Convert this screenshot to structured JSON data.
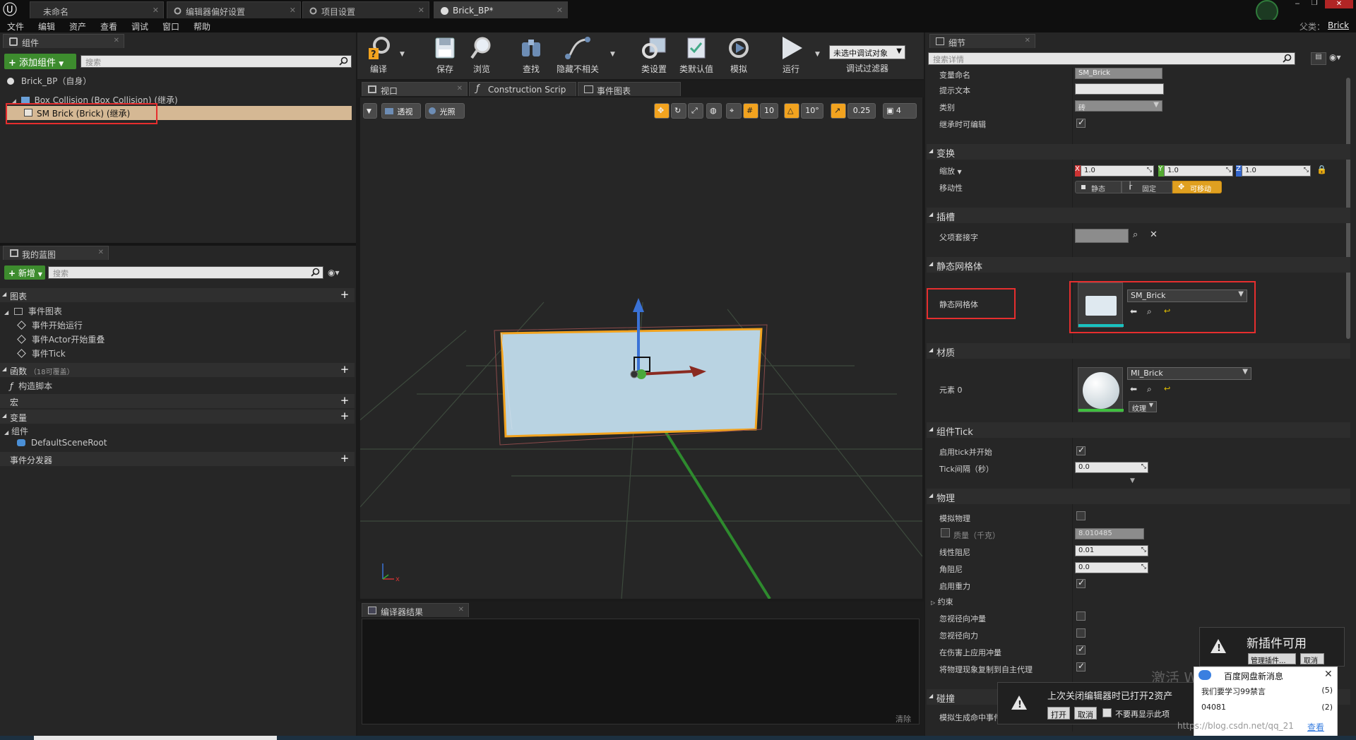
{
  "titlebar": {
    "tabs": [
      {
        "label": "未命名"
      },
      {
        "label": "编辑器偏好设置"
      },
      {
        "label": "项目设置"
      },
      {
        "label": "Brick_BP*"
      }
    ],
    "parent_label": "父类：",
    "parent_value": "Brick"
  },
  "menu": [
    "文件",
    "编辑",
    "资产",
    "查看",
    "调试",
    "窗口",
    "帮助"
  ],
  "components": {
    "tab": "组件",
    "add_button": "添加组件",
    "search_placeholder": "搜索",
    "root": "Brick_BP（自身）",
    "items": [
      "Box Collision (Box Collision) (继承)",
      "SM Brick (Brick) (继承)"
    ]
  },
  "my_blueprint": {
    "tab": "我的蓝图",
    "new_button": "新增",
    "search_placeholder": "搜索",
    "sections": {
      "graphs": "图表",
      "event_graph": "事件图表",
      "events": [
        "事件开始运行",
        "事件Actor开始重叠",
        "事件Tick"
      ],
      "functions": "函数",
      "functions_count": "（18可覆盖）",
      "construction": "构造脚本",
      "macros": "宏",
      "variables": "变量",
      "components_group": "组件",
      "default_root": "DefaultSceneRoot",
      "dispatchers": "事件分发器"
    }
  },
  "toolbar": {
    "buttons": [
      "编译",
      "保存",
      "浏览",
      "查找",
      "隐藏不相关",
      "类设置",
      "类默认值",
      "模拟",
      "运行"
    ],
    "debug_combo": "未选中调试对象",
    "debug_label": "调试过滤器"
  },
  "editor_tabs": [
    "视口",
    "Construction Scrip",
    "事件图表"
  ],
  "viewport": {
    "perspective": "透视",
    "lit": "光照",
    "grid_snap": "10",
    "rot_snap": "10°",
    "scale_snap": "0.25",
    "cam_speed": "4"
  },
  "compiler": {
    "tab": "编译器结果",
    "clear": "清除"
  },
  "details": {
    "tab": "细节",
    "search_placeholder": "搜索详情",
    "var_name_label": "变量命名",
    "var_name_value": "SM_Brick",
    "tooltip_label": "提示文本",
    "tooltip_value": "",
    "category_label": "类别",
    "category_value": "砖",
    "editable_label": "继承时可编辑",
    "transform_hdr": "变换",
    "scale_label": "缩放",
    "scale_x": "1.0",
    "scale_y": "1.0",
    "scale_z": "1.0",
    "mobility_label": "移动性",
    "mobility_options": [
      "静态",
      "固定",
      "可移动"
    ],
    "socket_hdr": "插槽",
    "parent_socket_label": "父项套接字",
    "static_mesh_hdr": "静态网格体",
    "static_mesh_label": "静态网格体",
    "static_mesh_value": "SM_Brick",
    "materials_hdr": "材质",
    "element0_label": "元素 0",
    "element0_value": "MI_Brick",
    "texture_btn": "纹理",
    "tick_hdr": "组件Tick",
    "tick_start_label": "启用tick并开始",
    "tick_interval_label": "Tick间隔（秒）",
    "tick_interval_value": "0.0",
    "physics_hdr": "物理",
    "sim_physics_label": "模拟物理",
    "mass_label": "质量（千克）",
    "mass_value": "8.010485",
    "linear_damping_label": "线性阻尼",
    "linear_damping_value": "0.01",
    "angular_damping_label": "角阻尼",
    "angular_damping_value": "0.0",
    "gravity_label": "启用重力",
    "constraints_label": "约束",
    "ignore_radial_impulse": "忽视径向冲量",
    "ignore_radial_force": "忽视径向力",
    "apply_impulse_damage": "在伤害上应用冲量",
    "replicate_physics": "将物理现象复制到自主代理",
    "collision_hdr": "碰撞",
    "sim_hit_events": "模拟生成命中事件"
  },
  "notifications": {
    "plugins_title": "新插件可用",
    "manage_plugins": "管理插件...",
    "cancel": "取消",
    "restore_text": "上次关闭编辑器时已打开2资产",
    "open": "打开",
    "restore_cancel": "取消",
    "dont_show": "不要再显示此项",
    "baidu_title": "百度网盘新消息",
    "baidu_items": [
      {
        "text": "我们要学习99禁言",
        "count": "(5)"
      },
      {
        "text": "04081",
        "count": "(2)"
      }
    ],
    "baidu_view": "查看",
    "watermark": "激活 Windows",
    "url_watermark": "https://blog.csdn.net/qq_21"
  }
}
